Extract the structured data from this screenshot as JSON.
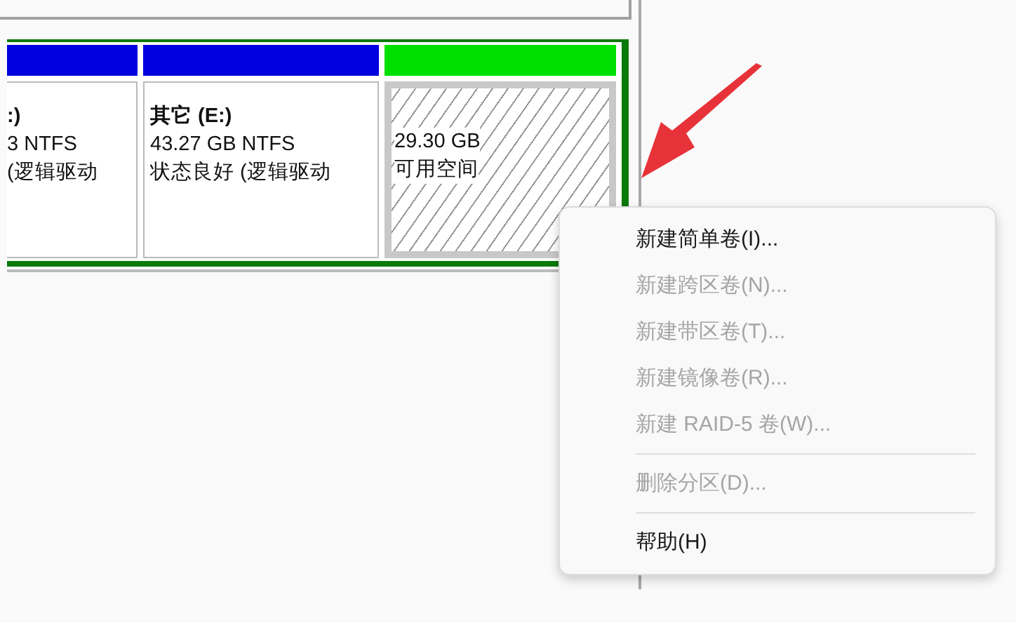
{
  "partitions": [
    {
      "kind": "volume",
      "color": "#0000e0",
      "title": ":)",
      "lines": [
        "3 NTFS",
        "(逻辑驱动"
      ]
    },
    {
      "kind": "volume",
      "color": "#0000e0",
      "title": "其它  (E:)",
      "lines": [
        "43.27 GB NTFS",
        "状态良好 (逻辑驱动"
      ]
    },
    {
      "kind": "free",
      "color": "#00e000",
      "lines": [
        "29.30 GB",
        "可用空间"
      ]
    }
  ],
  "context_menu": {
    "items": [
      {
        "kind": "item",
        "label": "新建简单卷(I)...",
        "disabled": false
      },
      {
        "kind": "item",
        "label": "新建跨区卷(N)...",
        "disabled": true
      },
      {
        "kind": "item",
        "label": "新建带区卷(T)...",
        "disabled": true
      },
      {
        "kind": "item",
        "label": "新建镜像卷(R)...",
        "disabled": true
      },
      {
        "kind": "item",
        "label": "新建 RAID-5 卷(W)...",
        "disabled": true
      },
      {
        "kind": "separator"
      },
      {
        "kind": "item",
        "label": "删除分区(D)...",
        "disabled": true
      },
      {
        "kind": "separator"
      },
      {
        "kind": "item",
        "label": "帮助(H)",
        "disabled": false
      }
    ]
  }
}
